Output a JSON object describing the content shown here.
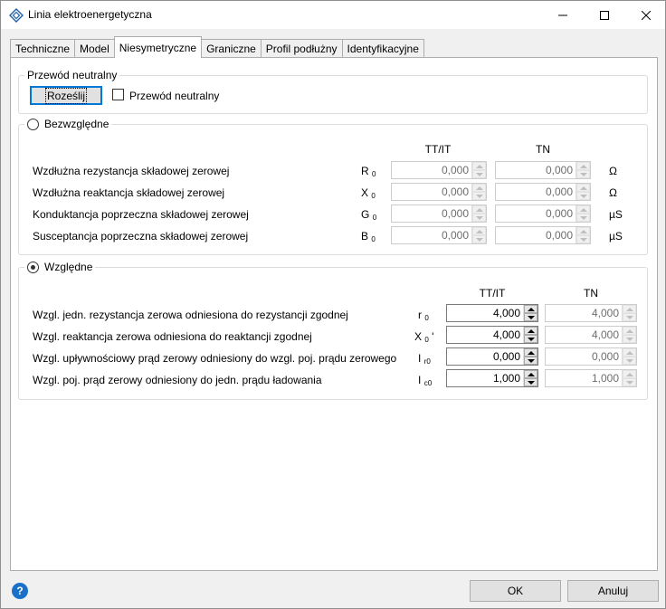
{
  "window": {
    "title": "Linia elektroenergetyczna"
  },
  "tabs": [
    {
      "label": "Techniczne"
    },
    {
      "label": "Model"
    },
    {
      "label": "Niesymetryczne"
    },
    {
      "label": "Graniczne"
    },
    {
      "label": "Profil podłużny"
    },
    {
      "label": "Identyfikacyjne"
    }
  ],
  "neutral": {
    "group_title": "Przewód neutralny",
    "distribute_button": "Roześlij",
    "checkbox_label": "Przewód neutralny",
    "checkbox_checked": false
  },
  "absolute": {
    "option_label": "Bezwzględne",
    "selected": false,
    "col1": "TT/IT",
    "col2": "TN",
    "rows": [
      {
        "label": "Wzdłużna rezystancja składowej zerowej",
        "sym": "R",
        "sub": "0",
        "v1": "0,000",
        "v2": "0,000",
        "unit": "Ω"
      },
      {
        "label": "Wzdłużna reaktancja składowej zerowej",
        "sym": "X",
        "sub": "0",
        "v1": "0,000",
        "v2": "0,000",
        "unit": "Ω"
      },
      {
        "label": "Konduktancja poprzeczna składowej zerowej",
        "sym": "G",
        "sub": "0",
        "v1": "0,000",
        "v2": "0,000",
        "unit": "µS"
      },
      {
        "label": "Susceptancja poprzeczna składowej zerowej",
        "sym": "B",
        "sub": "0",
        "v1": "0,000",
        "v2": "0,000",
        "unit": "µS"
      }
    ]
  },
  "relative": {
    "option_label": "Względne",
    "selected": true,
    "col1": "TT/IT",
    "col2": "TN",
    "rows": [
      {
        "label": "Wzgl. jedn. rezystancja zerowa odniesiona do rezystancji zgodnej",
        "sym": "r",
        "sub": "0",
        "v1": "4,000",
        "v2": "4,000"
      },
      {
        "label": "Wzgl. reaktancja zerowa odniesiona do reaktancji zgodnej",
        "sym": "X",
        "sub": "0",
        "suffix": "'",
        "v1": "4,000",
        "v2": "4,000"
      },
      {
        "label": "Wzgl. upływnościowy prąd zerowy odniesiony do wzgl. poj. prądu zerowego",
        "sym": "I",
        "sub": "r0",
        "v1": "0,000",
        "v2": "0,000"
      },
      {
        "label": "Wzgl. poj. prąd zerowy odniesiony do jedn. prądu ładowania",
        "sym": "I",
        "sub": "c0",
        "v1": "1,000",
        "v2": "1,000"
      }
    ]
  },
  "footer": {
    "help": "?",
    "ok": "OK",
    "cancel": "Anuluj"
  }
}
